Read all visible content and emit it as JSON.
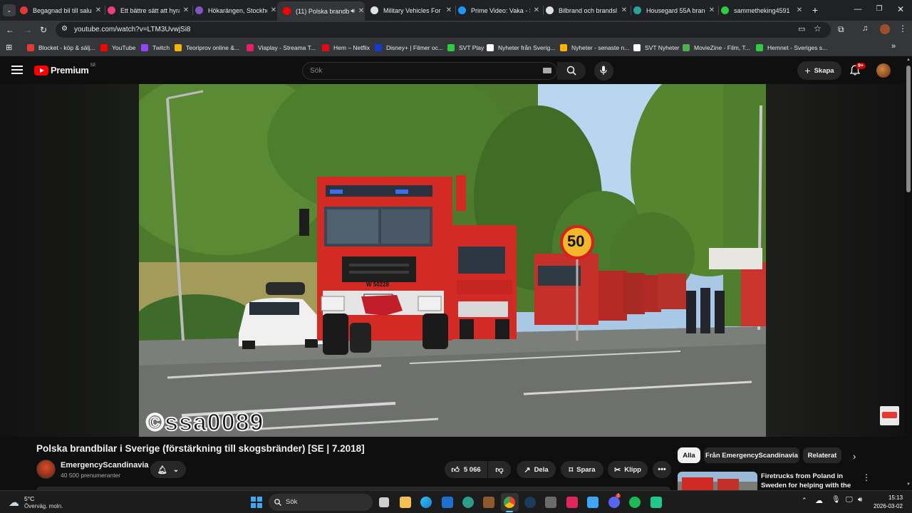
{
  "tabs": [
    {
      "title": "Begagnad bil till salu",
      "color": "#e53935"
    },
    {
      "title": "Ett bättre sätt att hyra",
      "color": "#ec407a"
    },
    {
      "title": "Hökarängen, Stockholm",
      "color": "#7e57c2"
    },
    {
      "title": "(11) Polska brandb",
      "color": "#ff0000",
      "active": true
    },
    {
      "title": "Military Vehicles For",
      "color": "#e0e0e0"
    },
    {
      "title": "Prime Video: Vaka - S",
      "color": "#1a98ff"
    },
    {
      "title": "Bilbrand och brandsl",
      "color": "#e0e0e0"
    },
    {
      "title": "Housegard 55A brand",
      "color": "#26a69a"
    },
    {
      "title": "sammetheking4591",
      "color": "#2ecc40"
    }
  ],
  "omnibox": {
    "url": "youtube.com/watch?v=LTM3UvwjSi8"
  },
  "bookmarks": [
    {
      "label": "Blocket - köp & sälj...",
      "color": "#e53935"
    },
    {
      "label": "YouTube",
      "color": "#ff0000"
    },
    {
      "label": "Twitch",
      "color": "#9146ff"
    },
    {
      "label": "Teoriprov online &...",
      "color": "#f4b400"
    },
    {
      "label": "Viaplay - Streama T...",
      "color": "#e91e63"
    },
    {
      "label": "Hem – Netflix",
      "color": "#e50914"
    },
    {
      "label": "Disney+ | Filmer oc...",
      "color": "#113ccf"
    },
    {
      "label": "SVT Play",
      "color": "#2ecc40"
    },
    {
      "label": "Nyheter från Sverig...",
      "color": "#ffffff"
    },
    {
      "label": "Nyheter - senaste n...",
      "color": "#ffb300"
    },
    {
      "label": "SVT Nyheter",
      "color": "#ffffff"
    },
    {
      "label": "MovieZine - Film, T...",
      "color": "#4caf50"
    },
    {
      "label": "Hemnet - Sveriges s...",
      "color": "#2ecc40"
    }
  ],
  "yt": {
    "logo": "Premium",
    "region": "SE",
    "search_placeholder": "Sök",
    "create": "Skapa",
    "notif": "9+"
  },
  "video": {
    "watermark": "©ssa0089",
    "speed_sign": "50",
    "plate": "W 50228"
  },
  "meta": {
    "title": "Polska brandbilar i Sverige (förstärkning till skogsbränder) [SE | 7.2018]",
    "channel": "EmergencyScandinavia",
    "subs": "40 500 prenumeranter",
    "likes": "5 066",
    "share": "Dela",
    "save": "Spara",
    "clip": "Klipp"
  },
  "filters": [
    "Alla",
    "Från EmergencyScandinavia",
    "Relaterat"
  ],
  "rec": {
    "title": "Firetrucks from Poland in Sweden for helping with the bi..."
  },
  "taskbar": {
    "temp": "5°C",
    "weather": "Överväg. moln.",
    "search": "Sök",
    "time": "15:13",
    "date": "2026-03-02",
    "discord_badge": "2"
  },
  "colors": {
    "yt_red": "#ff0000",
    "truck_red": "#d42a24",
    "accent_blue": "#3ea6ff"
  }
}
